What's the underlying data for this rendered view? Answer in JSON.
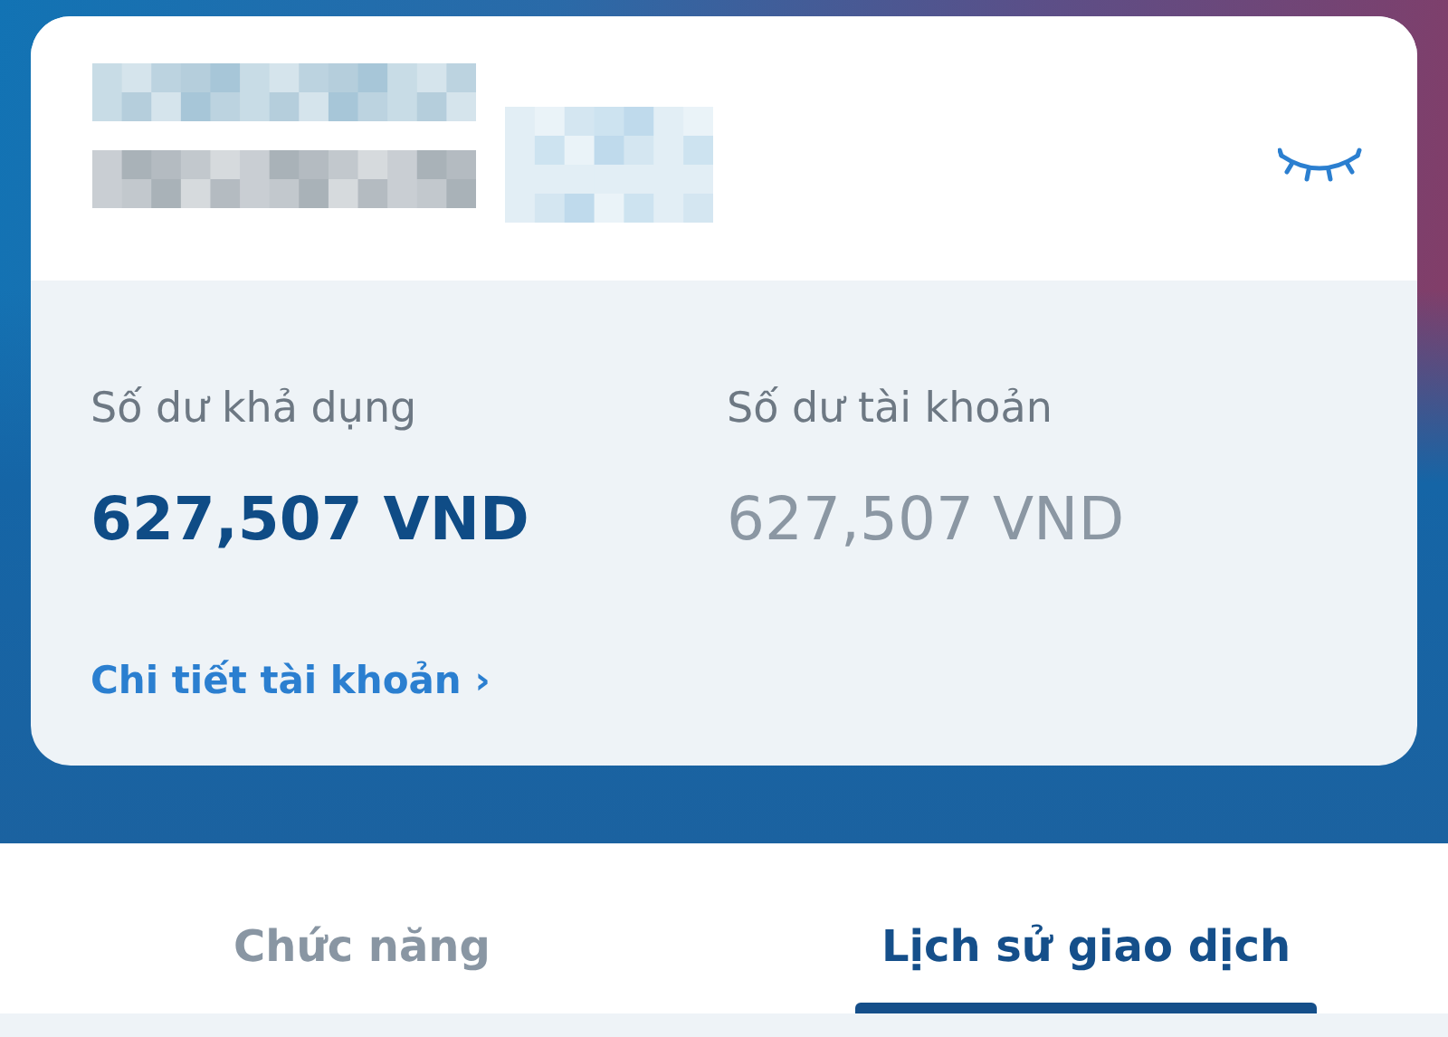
{
  "account": {
    "balance_hidden": true
  },
  "balances": [
    {
      "label": "Số dư khả dụng",
      "amount": "627,507 VND",
      "kind": "primary"
    },
    {
      "label": "Số dư tài khoản",
      "amount": "627,507 VND",
      "kind": "secondary"
    }
  ],
  "details_link": {
    "label": "Chi tiết tài khoản",
    "chevron": "›"
  },
  "tabs": [
    {
      "label": "Chức năng",
      "selected": false
    },
    {
      "label": "Lịch sử giao dịch",
      "selected": true
    }
  ]
}
